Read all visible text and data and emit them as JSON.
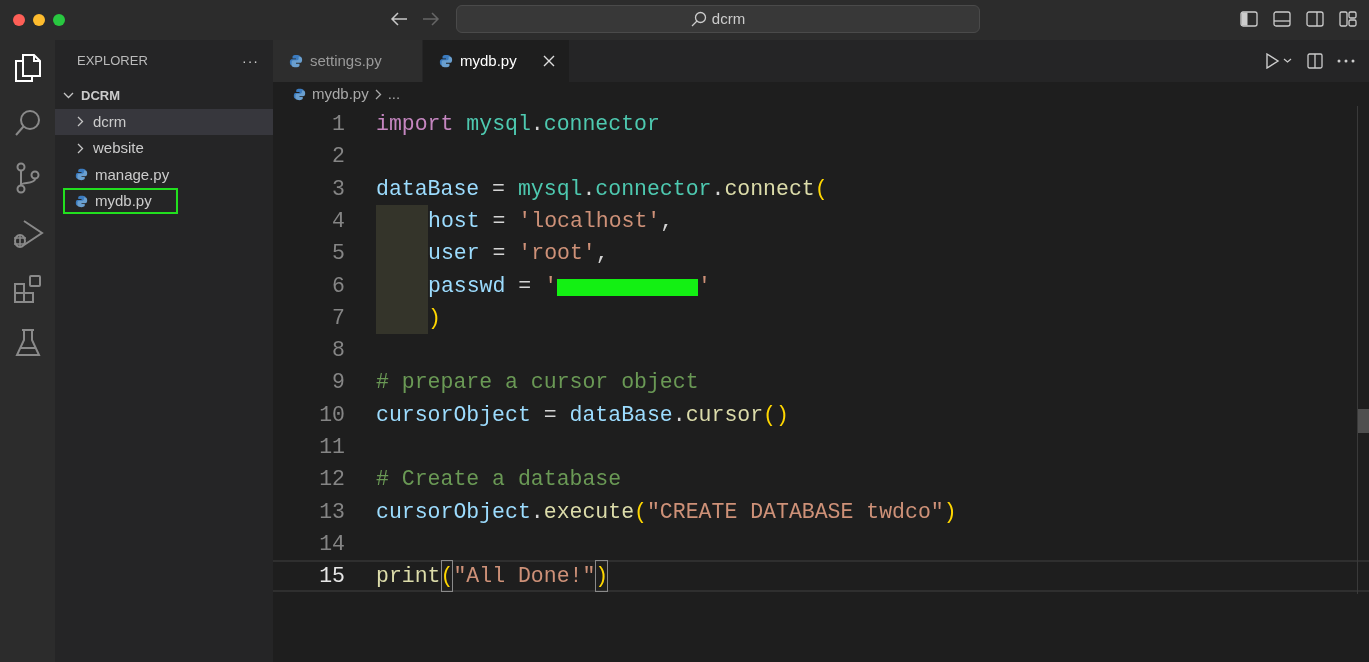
{
  "window": {
    "search": "dcrm"
  },
  "sidebar": {
    "title": "EXPLORER",
    "more": "···",
    "tree": [
      {
        "label": "DCRM",
        "kind": "folder",
        "expanded": true,
        "selected": false,
        "outlined": false,
        "children": [
          {
            "label": "dcrm",
            "kind": "folder",
            "expanded": false,
            "selected": true,
            "outlined": false
          },
          {
            "label": "website",
            "kind": "folder",
            "expanded": false,
            "selected": false,
            "outlined": false
          },
          {
            "label": "manage.py",
            "kind": "python",
            "selected": false,
            "outlined": false
          },
          {
            "label": "mydb.py",
            "kind": "python",
            "selected": false,
            "outlined": true
          }
        ]
      }
    ]
  },
  "tabs": [
    {
      "label": "settings.py",
      "selected": false,
      "closable": false
    },
    {
      "label": "mydb.py",
      "selected": true,
      "closable": true
    }
  ],
  "breadcrumb": {
    "file": "mydb.py",
    "rest": "..."
  },
  "editor": {
    "lines": [
      {
        "number": "1",
        "tokens": [
          {
            "kind": "keyword",
            "text": "import"
          },
          {
            "kind": "module",
            "text": " mysql"
          },
          {
            "kind": "plain",
            "text": "."
          },
          {
            "kind": "module",
            "text": "connector"
          }
        ]
      },
      {
        "number": "2"
      },
      {
        "number": "3",
        "tokens": [
          {
            "kind": "variable",
            "text": "dataBase"
          },
          {
            "kind": "plain",
            "text": " = "
          },
          {
            "kind": "module",
            "text": "mysql"
          },
          {
            "kind": "plain",
            "text": "."
          },
          {
            "kind": "module",
            "text": "connector"
          },
          {
            "kind": "plain",
            "text": "."
          },
          {
            "kind": "function",
            "text": "connect"
          },
          {
            "kind": "paren",
            "text": "("
          }
        ]
      },
      {
        "number": "4",
        "indent": true,
        "tokens": [
          {
            "kind": "variable",
            "text": "host"
          },
          {
            "kind": "plain",
            "text": " = "
          },
          {
            "kind": "string",
            "text": "'localhost'"
          },
          {
            "kind": "plain",
            "text": ","
          }
        ]
      },
      {
        "number": "5",
        "indent": true,
        "tokens": [
          {
            "kind": "variable",
            "text": "user"
          },
          {
            "kind": "plain",
            "text": " = "
          },
          {
            "kind": "string",
            "text": "'root'"
          },
          {
            "kind": "plain",
            "text": ","
          }
        ]
      },
      {
        "number": "6",
        "indent": true,
        "tokens": [
          {
            "kind": "variable",
            "text": "passwd"
          },
          {
            "kind": "plain",
            "text": " = "
          },
          {
            "kind": "string",
            "text": "'"
          },
          {
            "kind": "redaction"
          },
          {
            "kind": "string",
            "text": "'"
          }
        ]
      },
      {
        "number": "7",
        "indent": true,
        "tokens": [
          {
            "kind": "paren",
            "text": ")"
          }
        ]
      },
      {
        "number": "8"
      },
      {
        "number": "9",
        "tokens": [
          {
            "kind": "comment",
            "text": "# prepare a cursor object"
          }
        ]
      },
      {
        "number": "10",
        "tokens": [
          {
            "kind": "variable",
            "text": "cursorObject"
          },
          {
            "kind": "plain",
            "text": " = "
          },
          {
            "kind": "variable",
            "text": "dataBase"
          },
          {
            "kind": "plain",
            "text": "."
          },
          {
            "kind": "function",
            "text": "cursor"
          },
          {
            "kind": "paren",
            "text": "()"
          }
        ]
      },
      {
        "number": "11"
      },
      {
        "number": "12",
        "tokens": [
          {
            "kind": "comment",
            "text": "# Create a database"
          }
        ]
      },
      {
        "number": "13",
        "tokens": [
          {
            "kind": "variable",
            "text": "cursorObject"
          },
          {
            "kind": "plain",
            "text": "."
          },
          {
            "kind": "function",
            "text": "execute"
          },
          {
            "kind": "paren",
            "text": "("
          },
          {
            "kind": "string",
            "text": "\"CREATE DATABASE twdco\""
          },
          {
            "kind": "paren",
            "text": ")"
          }
        ]
      },
      {
        "number": "14"
      },
      {
        "number": "15",
        "current": true,
        "tokens": [
          {
            "kind": "function",
            "text": "print"
          },
          {
            "kind": "paren",
            "text": "(",
            "matched": true
          },
          {
            "kind": "string",
            "text": "\"All Done!\""
          },
          {
            "kind": "paren",
            "text": ")",
            "matched": true
          }
        ]
      }
    ]
  }
}
